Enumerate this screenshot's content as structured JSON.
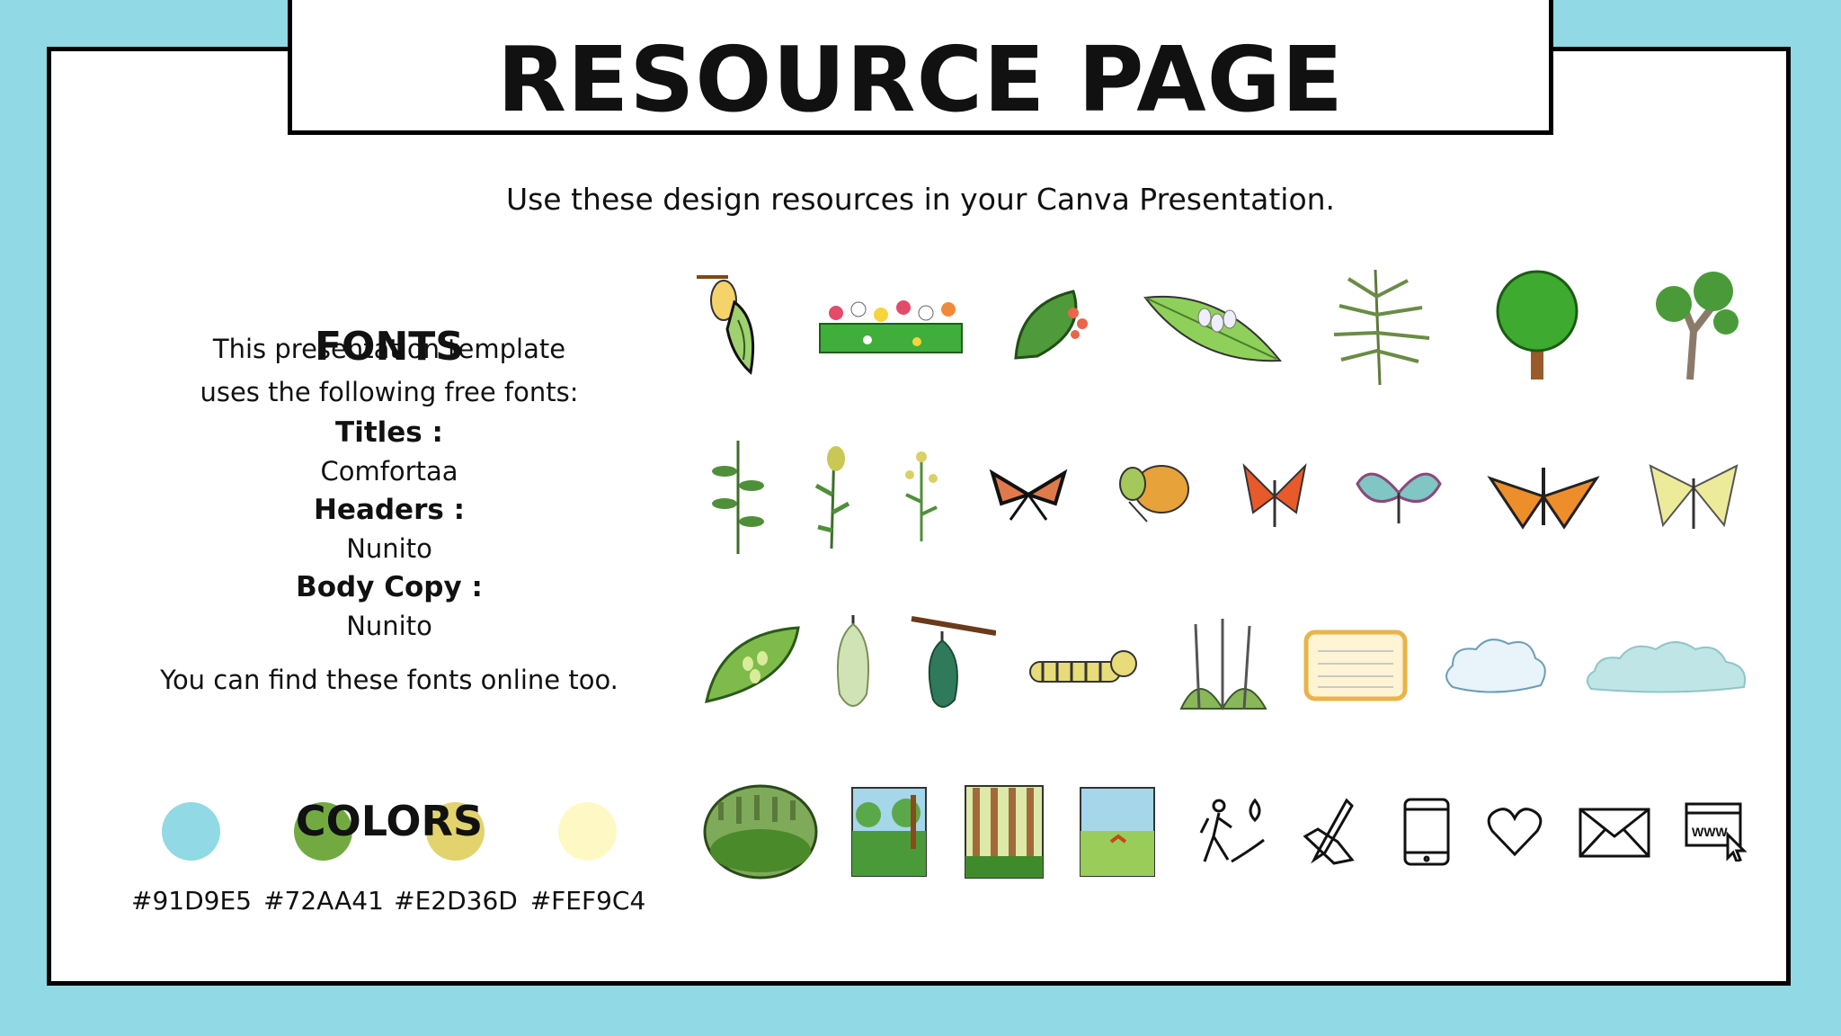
{
  "title": "RESOURCE PAGE",
  "subtitle": "Use these design resources in your Canva Presentation.",
  "fonts": {
    "heading": "FONTS",
    "intro_line1": "This presentation template",
    "intro_line2": "uses the following free fonts:",
    "titles_label": "Titles :",
    "titles_value": "Comfortaa",
    "headers_label": "Headers :",
    "headers_value": "Nunito",
    "body_label": "Body Copy :",
    "body_value": "Nunito",
    "note": "You can find these fonts online too."
  },
  "colors": {
    "heading": "COLORS",
    "swatches": [
      {
        "hex": "#91D9E5"
      },
      {
        "hex": "#72AA41"
      },
      {
        "hex": "#E2D36D"
      },
      {
        "hex": "#FEF9C4"
      }
    ]
  },
  "assets": {
    "row1": [
      "chrysalis-butterfly-icon",
      "flower-bed-icon",
      "leaf-with-eggs-icon",
      "leaf-eggs-icon",
      "rosemary-icon",
      "round-tree-icon",
      "bonsai-tree-icon"
    ],
    "row2": [
      "milkweed-icon",
      "goldenrod-icon",
      "small-flower-plant-icon",
      "black-orange-butterfly-icon",
      "orange-butterfly-icon",
      "red-butterfly-icon",
      "blue-butterfly-icon",
      "monarch-butterfly-icon",
      "yellow-butterfly-icon"
    ],
    "row3": [
      "leaf-eggs-large-icon",
      "green-chrysalis-icon",
      "hanging-chrysalis-icon",
      "caterpillar-icon",
      "grass-tuft-icon",
      "lined-note-icon",
      "cloud-icon",
      "wide-cloud-icon"
    ],
    "row4": [
      "forest-oval-icon",
      "forest-square-icon",
      "tall-forest-icon",
      "meadow-icon",
      "hiker-icon",
      "pen-hand-icon",
      "phone-icon",
      "heart-icon",
      "envelope-icon",
      "www-icon"
    ]
  }
}
